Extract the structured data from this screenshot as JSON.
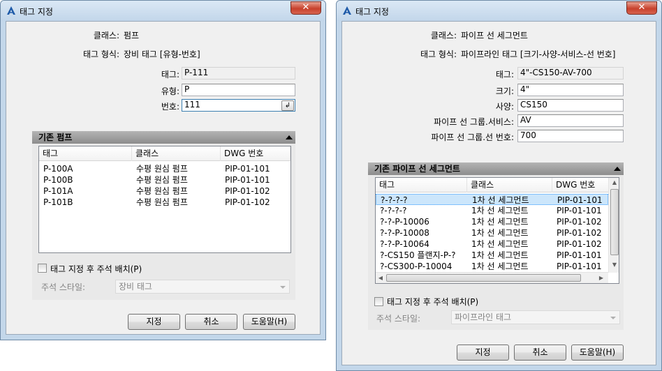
{
  "left": {
    "title": "태그 지정",
    "close": "✕",
    "class_label": "클래스:",
    "class_value": "펌프",
    "format_label": "태그 형식:",
    "format_value": "장비 태그 [유형-번호]",
    "fields": [
      {
        "label": "태그:",
        "value": "P-111"
      },
      {
        "label": "유형:",
        "value": "P"
      },
      {
        "label": "번호:",
        "value": "111"
      }
    ],
    "group_title": "기존 펌프",
    "columns": [
      "태그",
      "클래스",
      "DWG 번호"
    ],
    "rows": [
      [
        "P-100A",
        "수평 원심 펌프",
        "PIP-01-101"
      ],
      [
        "P-100B",
        "수평 원심 펌프",
        "PIP-01-101"
      ],
      [
        "P-101A",
        "수평 원심 펌프",
        "PIP-01-102"
      ],
      [
        "P-101B",
        "수평 원심 펌프",
        "PIP-01-102"
      ]
    ],
    "checkbox_label": "태그 지정 후 주석 배치(P)",
    "style_label": "주석 스타일:",
    "style_value": "장비 태그",
    "buttons": [
      "지정",
      "취소",
      "도움말(H)"
    ]
  },
  "right": {
    "title": "태그 지정",
    "close": "✕",
    "class_label": "클래스:",
    "class_value": "파이프 선 세그먼트",
    "format_label": "태그 형식:",
    "format_value": "파이프라인 태그 [크기-사양-서비스-선 번호]",
    "fields": [
      {
        "label": "태그:",
        "value": "4\"-CS150-AV-700"
      },
      {
        "label": "크기:",
        "value": "4\""
      },
      {
        "label": "사양:",
        "value": "CS150"
      },
      {
        "label": "파이프 선 그룹.서비스:",
        "value": "AV"
      },
      {
        "label": "파이프 선 그룹.선 번호:",
        "value": "700"
      }
    ],
    "group_title": "기존 파이프 선 세그먼트",
    "columns": [
      "태그",
      "클래스",
      "DWG 번호"
    ],
    "rows": [
      [
        "?-?-?-?",
        "1차 선 세그먼트",
        "PIP-01-101"
      ],
      [
        "?-?-?-?",
        "1차 선 세그먼트",
        "PIP-01-101"
      ],
      [
        "?-?-P-10006",
        "1차 선 세그먼트",
        "PIP-01-102"
      ],
      [
        "?-?-P-10008",
        "1차 선 세그먼트",
        "PIP-01-102"
      ],
      [
        "?-?-P-10064",
        "1차 선 세그먼트",
        "PIP-01-102"
      ],
      [
        "?-CS150 플랜지-P-?",
        "1차 선 세그먼트",
        "PIP-01-101"
      ],
      [
        "?-CS300-P-10004",
        "1차 선 세그먼트",
        "PIP-01-101"
      ]
    ],
    "checkbox_label": "태그 지정 후 주석 배치(P)",
    "style_label": "주석 스타일:",
    "style_value": "파이프라인 태그",
    "buttons": [
      "지정",
      "취소",
      "도움말(H)"
    ]
  },
  "icons": {
    "app": "autocad-plant-icon",
    "browse": "browse-icon"
  }
}
